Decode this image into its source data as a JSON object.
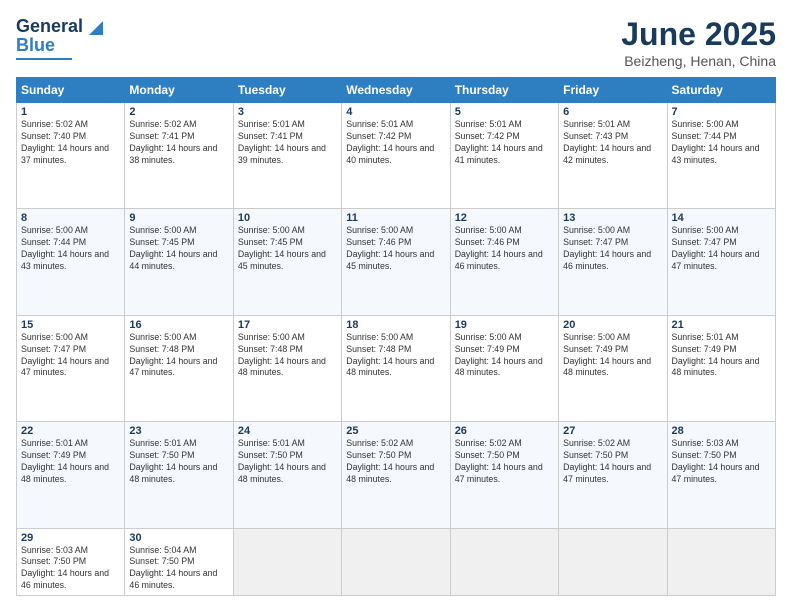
{
  "logo": {
    "text1": "General",
    "text2": "Blue"
  },
  "title": "June 2025",
  "subtitle": "Beizheng, Henan, China",
  "weekdays": [
    "Sunday",
    "Monday",
    "Tuesday",
    "Wednesday",
    "Thursday",
    "Friday",
    "Saturday"
  ],
  "weeks": [
    [
      {
        "day": "1",
        "sunrise": "5:02 AM",
        "sunset": "7:40 PM",
        "daylight": "14 hours and 37 minutes."
      },
      {
        "day": "2",
        "sunrise": "5:02 AM",
        "sunset": "7:41 PM",
        "daylight": "14 hours and 38 minutes."
      },
      {
        "day": "3",
        "sunrise": "5:01 AM",
        "sunset": "7:41 PM",
        "daylight": "14 hours and 39 minutes."
      },
      {
        "day": "4",
        "sunrise": "5:01 AM",
        "sunset": "7:42 PM",
        "daylight": "14 hours and 40 minutes."
      },
      {
        "day": "5",
        "sunrise": "5:01 AM",
        "sunset": "7:42 PM",
        "daylight": "14 hours and 41 minutes."
      },
      {
        "day": "6",
        "sunrise": "5:01 AM",
        "sunset": "7:43 PM",
        "daylight": "14 hours and 42 minutes."
      },
      {
        "day": "7",
        "sunrise": "5:00 AM",
        "sunset": "7:44 PM",
        "daylight": "14 hours and 43 minutes."
      }
    ],
    [
      {
        "day": "8",
        "sunrise": "5:00 AM",
        "sunset": "7:44 PM",
        "daylight": "14 hours and 43 minutes."
      },
      {
        "day": "9",
        "sunrise": "5:00 AM",
        "sunset": "7:45 PM",
        "daylight": "14 hours and 44 minutes."
      },
      {
        "day": "10",
        "sunrise": "5:00 AM",
        "sunset": "7:45 PM",
        "daylight": "14 hours and 45 minutes."
      },
      {
        "day": "11",
        "sunrise": "5:00 AM",
        "sunset": "7:46 PM",
        "daylight": "14 hours and 45 minutes."
      },
      {
        "day": "12",
        "sunrise": "5:00 AM",
        "sunset": "7:46 PM",
        "daylight": "14 hours and 46 minutes."
      },
      {
        "day": "13",
        "sunrise": "5:00 AM",
        "sunset": "7:47 PM",
        "daylight": "14 hours and 46 minutes."
      },
      {
        "day": "14",
        "sunrise": "5:00 AM",
        "sunset": "7:47 PM",
        "daylight": "14 hours and 47 minutes."
      }
    ],
    [
      {
        "day": "15",
        "sunrise": "5:00 AM",
        "sunset": "7:47 PM",
        "daylight": "14 hours and 47 minutes."
      },
      {
        "day": "16",
        "sunrise": "5:00 AM",
        "sunset": "7:48 PM",
        "daylight": "14 hours and 47 minutes."
      },
      {
        "day": "17",
        "sunrise": "5:00 AM",
        "sunset": "7:48 PM",
        "daylight": "14 hours and 48 minutes."
      },
      {
        "day": "18",
        "sunrise": "5:00 AM",
        "sunset": "7:48 PM",
        "daylight": "14 hours and 48 minutes."
      },
      {
        "day": "19",
        "sunrise": "5:00 AM",
        "sunset": "7:49 PM",
        "daylight": "14 hours and 48 minutes."
      },
      {
        "day": "20",
        "sunrise": "5:00 AM",
        "sunset": "7:49 PM",
        "daylight": "14 hours and 48 minutes."
      },
      {
        "day": "21",
        "sunrise": "5:01 AM",
        "sunset": "7:49 PM",
        "daylight": "14 hours and 48 minutes."
      }
    ],
    [
      {
        "day": "22",
        "sunrise": "5:01 AM",
        "sunset": "7:49 PM",
        "daylight": "14 hours and 48 minutes."
      },
      {
        "day": "23",
        "sunrise": "5:01 AM",
        "sunset": "7:50 PM",
        "daylight": "14 hours and 48 minutes."
      },
      {
        "day": "24",
        "sunrise": "5:01 AM",
        "sunset": "7:50 PM",
        "daylight": "14 hours and 48 minutes."
      },
      {
        "day": "25",
        "sunrise": "5:02 AM",
        "sunset": "7:50 PM",
        "daylight": "14 hours and 48 minutes."
      },
      {
        "day": "26",
        "sunrise": "5:02 AM",
        "sunset": "7:50 PM",
        "daylight": "14 hours and 47 minutes."
      },
      {
        "day": "27",
        "sunrise": "5:02 AM",
        "sunset": "7:50 PM",
        "daylight": "14 hours and 47 minutes."
      },
      {
        "day": "28",
        "sunrise": "5:03 AM",
        "sunset": "7:50 PM",
        "daylight": "14 hours and 47 minutes."
      }
    ],
    [
      {
        "day": "29",
        "sunrise": "5:03 AM",
        "sunset": "7:50 PM",
        "daylight": "14 hours and 46 minutes."
      },
      {
        "day": "30",
        "sunrise": "5:04 AM",
        "sunset": "7:50 PM",
        "daylight": "14 hours and 46 minutes."
      },
      null,
      null,
      null,
      null,
      null
    ]
  ]
}
